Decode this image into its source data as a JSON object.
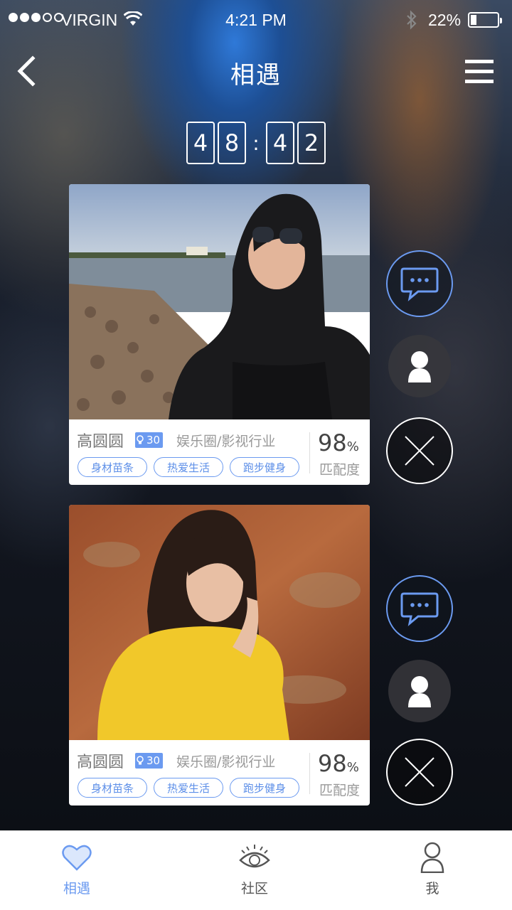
{
  "status_bar": {
    "carrier": "VIRGIN",
    "time": "4:21 PM",
    "battery": "22%",
    "signal_bars_filled": 3,
    "signal_bars_total": 5,
    "battery_level": 0.22
  },
  "nav": {
    "back_icon": "chevron-left-icon",
    "title": "相遇",
    "menu_icon": "hamburger-menu-icon"
  },
  "timer": {
    "digits": [
      "4",
      "8",
      "4",
      "2"
    ],
    "separator": ":"
  },
  "cards": [
    {
      "name": "高圆圆",
      "age": "30",
      "industry": "娱乐圈/影视行业",
      "tags": [
        "身材苗条",
        "热爱生活",
        "跑步健身"
      ],
      "match_value": "98",
      "match_unit": "%",
      "match_label": "匹配度"
    },
    {
      "name": "高圆圆",
      "age": "30",
      "industry": "娱乐圈/影视行业",
      "tags": [
        "身材苗条",
        "热爱生活",
        "跑步健身"
      ],
      "match_value": "98",
      "match_unit": "%",
      "match_label": "匹配度"
    }
  ],
  "tabbar": {
    "items": [
      {
        "label": "相遇",
        "icon": "heart-icon",
        "active": true
      },
      {
        "label": "社区",
        "icon": "eye-icon",
        "active": false
      },
      {
        "label": "我",
        "icon": "person-icon",
        "active": false
      }
    ]
  },
  "colors": {
    "accent": "#6b9af0",
    "tab_active": "#6b9af0",
    "tab_inactive": "#555555"
  }
}
